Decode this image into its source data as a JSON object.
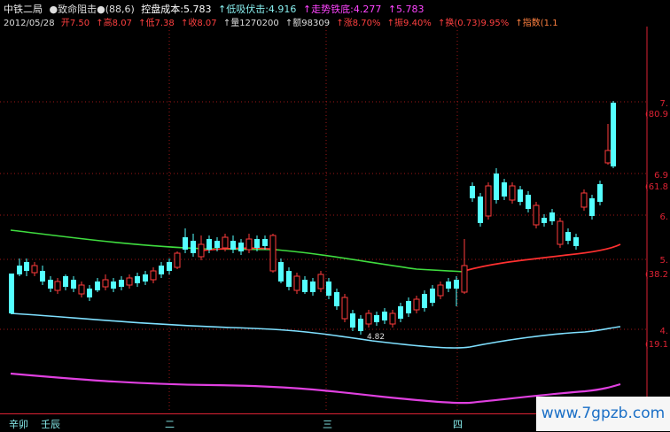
{
  "header": {
    "indicator_name": "中铁二局",
    "formula_a": "●致命阻击●(88,6)",
    "cost_label": "控盘成本:5.783",
    "low_absorb": "↑低吸伏击:4.916",
    "trend": "↑走势铁底:4.277",
    "trend_val2": "↑5.783",
    "date": "2012/05/28",
    "open": "开7.50",
    "high": "↑高8.07",
    "low": "↑低7.38",
    "close": "↑收8.07",
    "volume": "↑量1270200",
    "amount": "↑额98309",
    "change_pct": "↑涨8.70%",
    "amplitude": "↑振9.40%",
    "turnover": "↑换(0.73)9.95%",
    "index": "↑指数(1.1"
  },
  "axis": {
    "labels": [
      "7.",
      "(80.9",
      "6.9",
      "(61.8",
      "6.",
      "5.",
      "(38.2",
      "4.",
      "(19.1"
    ]
  },
  "annotation": {
    "low_mark": "4.82"
  },
  "bottom": {
    "tabs": [
      "辛卯",
      "壬辰",
      "二",
      "三",
      "四"
    ]
  },
  "watermark": "www.7gpzb.com",
  "colors": {
    "up": "#ff3b3b",
    "down": "#54ffff",
    "green_line": "#3fdc3f",
    "cyan_line": "#7fe0ff",
    "magenta_line": "#e040e0",
    "red_line": "#ff3030"
  }
}
